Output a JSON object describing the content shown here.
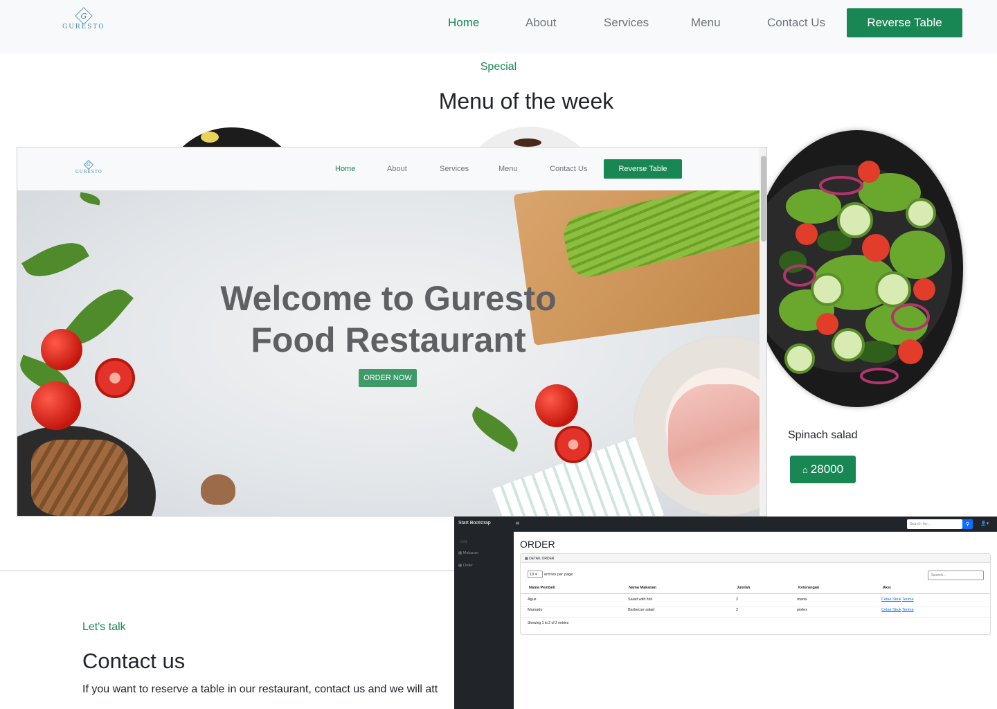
{
  "site": {
    "logo_letter": "G",
    "logo_text": "GURESTO",
    "nav": [
      "Home",
      "About",
      "Services",
      "Menu",
      "Contact Us"
    ],
    "reserve_button": "Reverse Table",
    "special_kicker": "Special",
    "special_title": "Menu of the week",
    "dish_name": "Spinach salad",
    "dish_price": "28000",
    "talk_kicker": "Let's talk",
    "contact_title": "Contact us",
    "contact_text": "If you want to reserve a table in our restaurant, contact us and we will att"
  },
  "hero": {
    "title_line1": "Welcome to Guresto",
    "title_line2": "Food Restaurant",
    "order_button": "ORDER NOW"
  },
  "admin": {
    "brand": "Start Bootstrap",
    "menu_icon": "≡",
    "search_placeholder": "Search for...",
    "sidebar_heading": "CORE",
    "sidebar_items": [
      "Makanan",
      "Order"
    ],
    "page_title": "ORDER",
    "card_title": "DETAIL ORDER",
    "entries_value": "10",
    "entries_label": "entries per page",
    "table_search_placeholder": "Search...",
    "columns": [
      "Nama Pembeli",
      "Nama Makanan",
      "Jumlah",
      "Keterangan",
      "Aksi"
    ],
    "rows": [
      {
        "pembeli": "Agus",
        "makanan": "Salad with fish",
        "jumlah": "2",
        "keterangan": "manis",
        "aksi1": "Cetak Struk",
        "aksi2": "Terima"
      },
      {
        "pembeli": "Marsadu",
        "makanan": "Barbecue salad",
        "jumlah": "2",
        "keterangan": "pedes",
        "aksi1": "Cetak Struk",
        "aksi2": "Terima"
      }
    ],
    "footer_info": "Showing 1 to 2 of 2 entries"
  },
  "colors": {
    "accent": "#198754",
    "dark": "#212529",
    "sidebar": "#212529"
  }
}
